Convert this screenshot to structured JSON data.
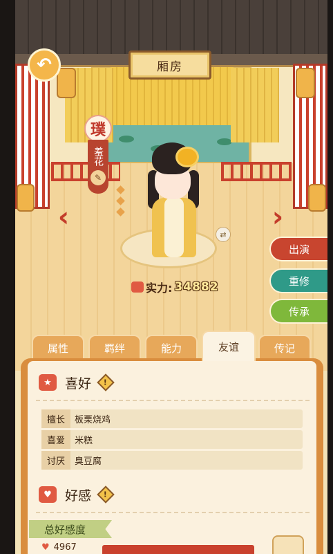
{
  "header": {
    "title": "厢房"
  },
  "character": {
    "badge": "璞",
    "name": "羞花",
    "power_label": "实力:",
    "power_value": "34882"
  },
  "side_actions": [
    {
      "label": "出演",
      "color": "#c8452f"
    },
    {
      "label": "重修",
      "color": "#2f9a88"
    },
    {
      "label": "传承",
      "color": "#7fb83b"
    }
  ],
  "tabs": [
    {
      "label": "属性",
      "active": false
    },
    {
      "label": "羁绊",
      "active": false
    },
    {
      "label": "能力",
      "active": false
    },
    {
      "label": "友谊",
      "active": true
    },
    {
      "label": "传记",
      "active": false
    }
  ],
  "preferences": {
    "title": "喜好",
    "rows": [
      {
        "label": "擅长",
        "value": "板栗烧鸡"
      },
      {
        "label": "喜爱",
        "value": "米糕"
      },
      {
        "label": "讨厌",
        "value": "臭豆腐"
      }
    ]
  },
  "favor": {
    "title": "好感",
    "total_label": "总好感度",
    "value": "4967"
  },
  "icons": {
    "back": "back-arrow-icon",
    "left": "chevron-left-icon",
    "right": "chevron-right-icon",
    "swap": "swap-icon",
    "power": "fist-icon"
  }
}
